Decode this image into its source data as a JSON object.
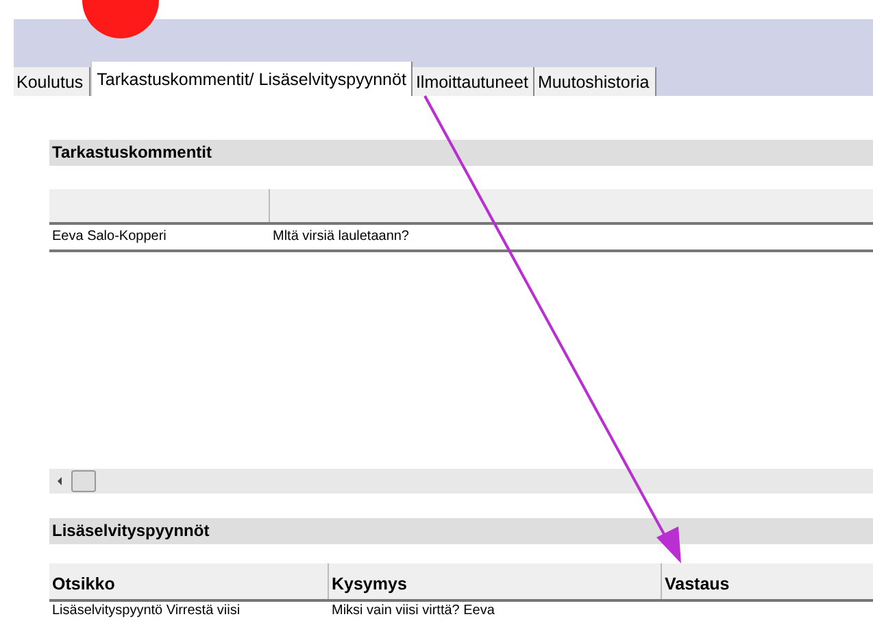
{
  "tabs": [
    {
      "label": "Koulutus",
      "selected": false
    },
    {
      "label": "Tarkastuskommentit/ Lisäselvityspyynnöt",
      "selected": true
    },
    {
      "label": "Ilmoittautuneet",
      "selected": false
    },
    {
      "label": "Muutoshistoria",
      "selected": false
    }
  ],
  "comments": {
    "title": "Tarkastuskommentit",
    "rows": [
      [
        "Eeva Salo-Kopperi",
        "Mltä virsiä lauletaann?"
      ]
    ]
  },
  "requests": {
    "title": "Lisäselvityspyynnöt",
    "columns": [
      "Otsikko",
      "Kysymys",
      "Vastaus"
    ],
    "rows": [
      [
        "Lisäselvityspyyntö Virrestä viisi",
        "Miksi vain viisi virttä? Eeva"
      ]
    ]
  }
}
